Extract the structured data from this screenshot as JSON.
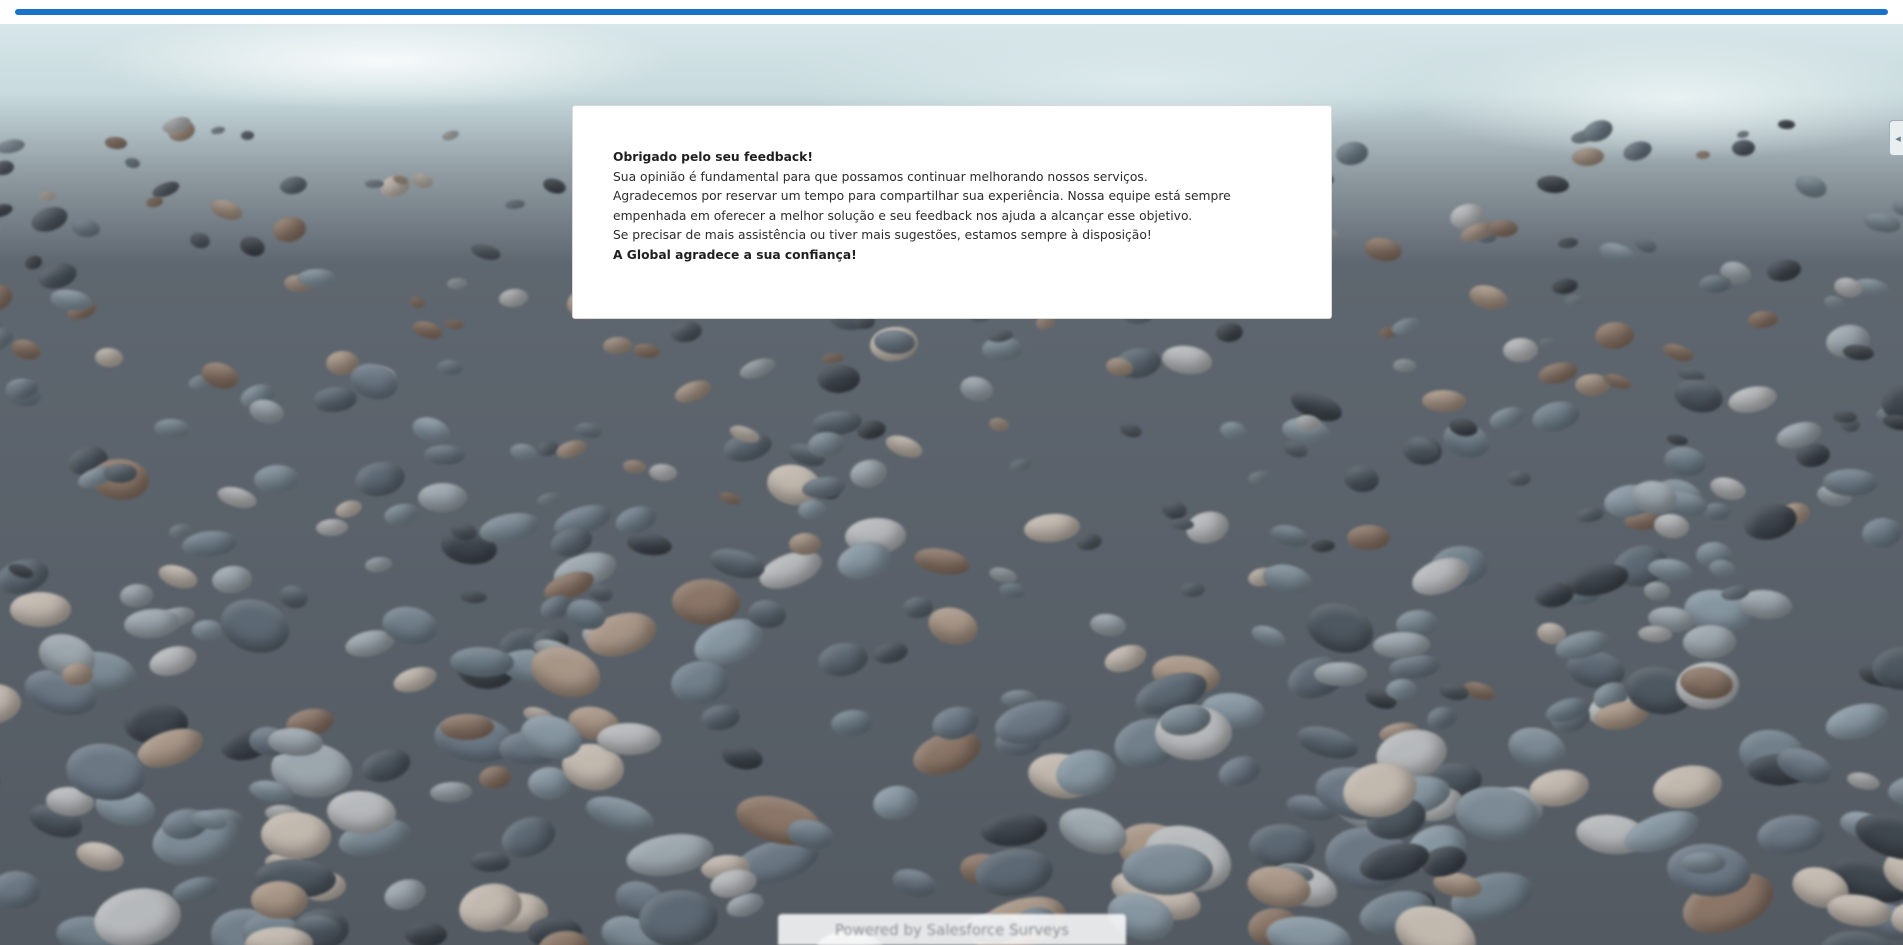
{
  "progress": {
    "value": 1.0,
    "color": "#1a73c9"
  },
  "message": {
    "title": "Obrigado pelo seu feedback!",
    "line1": "Sua opinião é fundamental para que possamos continuar melhorando nossos serviços.",
    "line2": "Agradecemos por reservar um tempo para compartilhar sua experiência. Nossa equipe está sempre empenhada em oferecer a melhor solução e seu feedback nos ajuda a alcançar esse objetivo.",
    "line3": "Se precisar de mais assistência ou tiver mais sugestões, estamos sempre à disposição!",
    "closing": "A Global agradece a sua confiança!"
  },
  "side_tab": {
    "icon": "arrow-left-icon",
    "glyph": "◂"
  },
  "footer": {
    "powered_by": "Powered by Salesforce Surveys"
  }
}
